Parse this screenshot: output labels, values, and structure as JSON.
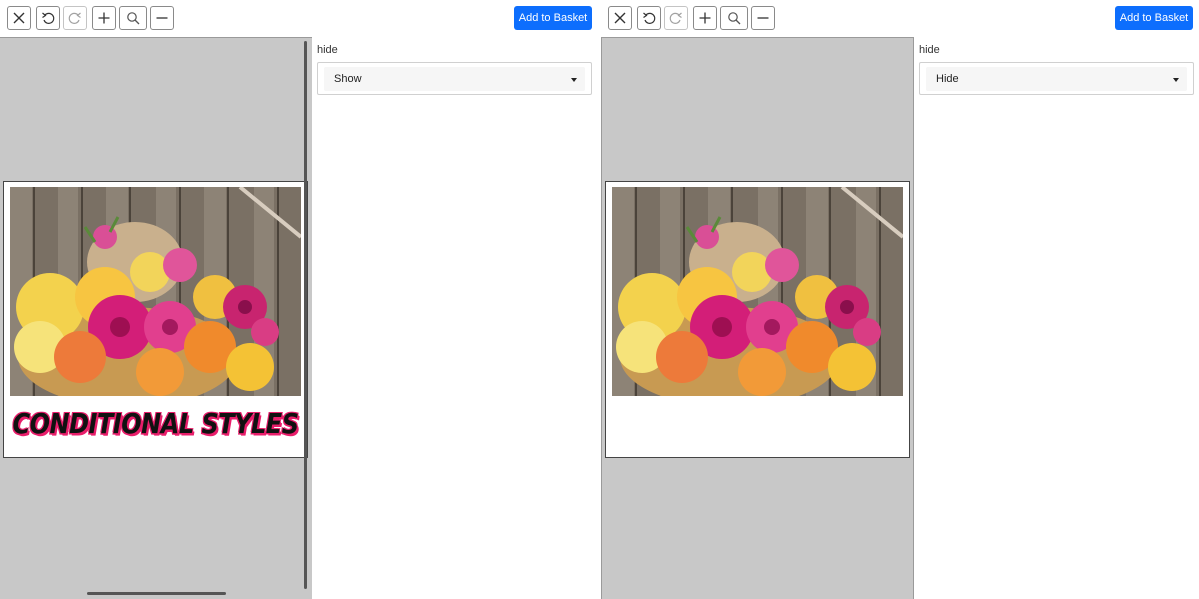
{
  "panels": [
    {
      "toolbar": {
        "buttons": [
          {
            "icon": "close-icon",
            "enabled": true
          },
          {
            "icon": "undo-icon",
            "enabled": true
          },
          {
            "icon": "redo-icon",
            "enabled": false
          },
          {
            "icon": "zoom-in-icon",
            "enabled": true
          },
          {
            "icon": "search-icon",
            "enabled": true
          },
          {
            "icon": "zoom-out-icon",
            "enabled": true
          }
        ],
        "add_to_basket_label": "Add to Basket"
      },
      "card": {
        "title": "CONDITIONAL STYLES"
      },
      "field": {
        "label": "hide",
        "selected": "Show"
      }
    },
    {
      "toolbar": {
        "buttons": [
          {
            "icon": "close-icon",
            "enabled": true
          },
          {
            "icon": "undo-icon",
            "enabled": true
          },
          {
            "icon": "redo-icon",
            "enabled": false
          },
          {
            "icon": "zoom-in-icon",
            "enabled": true
          },
          {
            "icon": "search-icon",
            "enabled": true
          },
          {
            "icon": "zoom-out-icon",
            "enabled": true
          }
        ],
        "add_to_basket_label": "Add to Basket"
      },
      "card": {
        "title": ""
      },
      "field": {
        "label": "hide",
        "selected": "Hide"
      }
    }
  ],
  "colors": {
    "primary_button": "#0d6efd",
    "stage_background": "#c8c8c8",
    "title_outline": "#e81e6b"
  }
}
